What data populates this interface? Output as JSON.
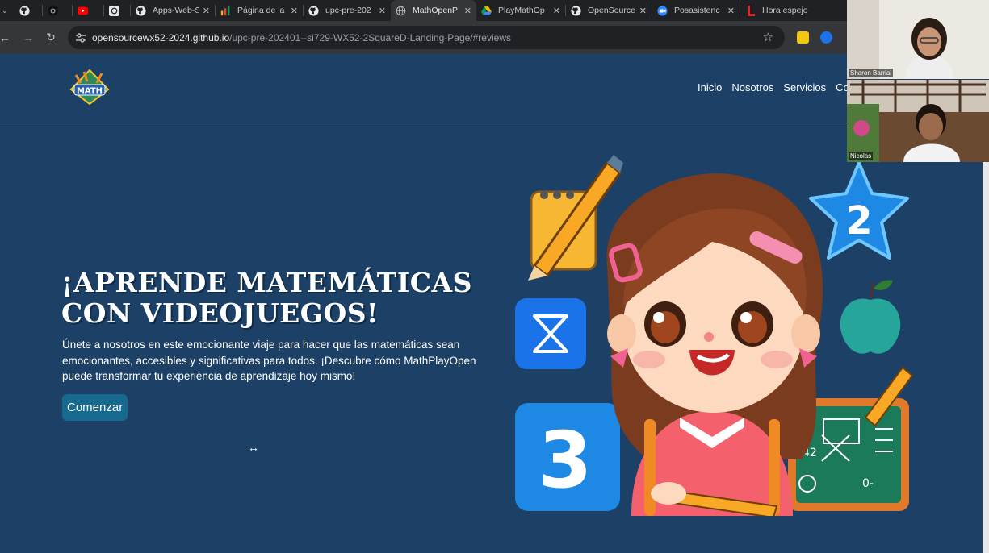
{
  "browser": {
    "tabs": [
      {
        "title": "",
        "icon": "github-icon",
        "active": false
      },
      {
        "title": "",
        "icon": "dark-app-icon",
        "active": false
      },
      {
        "title": "",
        "icon": "youtube-icon",
        "active": false
      },
      {
        "title": "",
        "icon": "openai-icon",
        "active": false
      },
      {
        "title": "Apps-Web-S",
        "icon": "github-icon",
        "active": false
      },
      {
        "title": "Página de la",
        "icon": "bar-chart-icon",
        "active": false
      },
      {
        "title": "upc-pre-202",
        "icon": "github-icon",
        "active": false
      },
      {
        "title": "MathOpenP",
        "icon": "globe-icon",
        "active": true
      },
      {
        "title": "PlayMathOp",
        "icon": "drive-icon",
        "active": false
      },
      {
        "title": "OpenSource",
        "icon": "github-icon",
        "active": false
      },
      {
        "title": "Posasistenc",
        "icon": "zoom-icon",
        "active": false
      },
      {
        "title": "Hora espejo",
        "icon": "l-logo-icon",
        "active": false
      }
    ],
    "url_host": "opensourcewx52-2024.github.io",
    "url_path": "/upc-pre-202401--si729-WX52-2SquareD-Landing-Page/#reviews"
  },
  "header": {
    "logo_text": "MATH",
    "nav": [
      "Inicio",
      "Nosotros",
      "Servicios",
      "Co"
    ]
  },
  "hero": {
    "title_line1": "¡APRENDE MATEMÁTICAS",
    "title_line2": "CON VIDEOJUEGOS!",
    "text_line1": "Únete a nosotros en este emocionante viaje para hacer que las matemáticas sean",
    "text_line2": "emocionantes, accesibles y significativas para todos. ¡Descubre cómo MathPlayOpen",
    "text_line3": "puede transformar tu experiencia de aprendizaje hoy mismo!",
    "cta": "Comenzar"
  },
  "illustration": {
    "star_number": "2",
    "block_number": "3",
    "board_marks": [
      "42",
      "0-"
    ]
  },
  "participants": [
    {
      "name": "Sharon Barrial"
    },
    {
      "name": "Nicolas"
    }
  ],
  "colors": {
    "page_bg": "#1d4166",
    "button_bg": "#166a8f",
    "tab_bar": "#202124",
    "toolbar": "#35363a"
  }
}
